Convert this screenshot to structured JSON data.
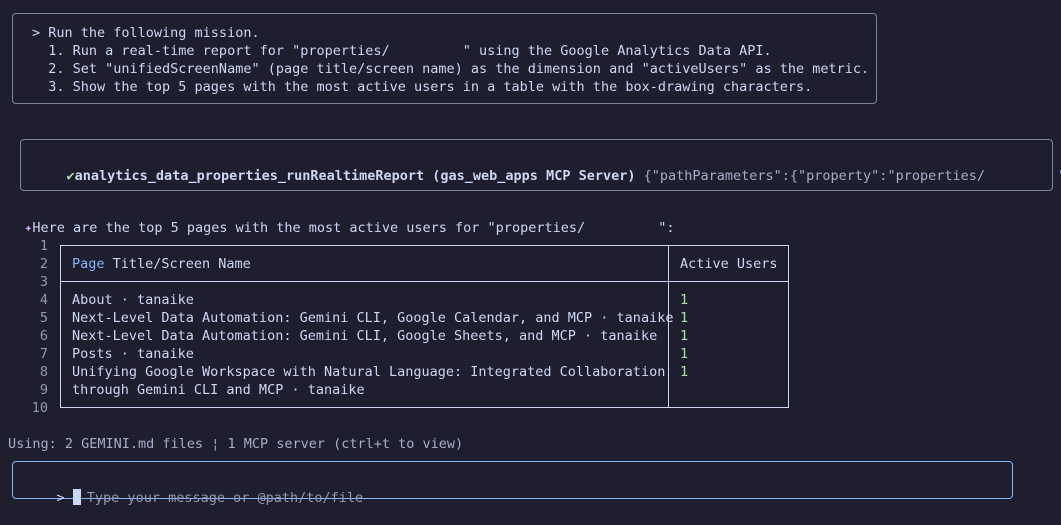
{
  "mission": {
    "lines": [
      "> Run the following mission.",
      "  1. Run a real-time report for \"properties/         \" using the Google Analytics Data API.",
      "  2. Set \"unifiedScreenName\" (page title/screen name) as the dimension and \"activeUsers\" as the metric.",
      "  3. Show the top 5 pages with the most active users in a table with the box-drawing characters."
    ]
  },
  "tool_call": {
    "check": "✔",
    "name": "analytics_data_properties_runRealtimeReport (gas_web_apps MCP Server)",
    "args": "{\"pathParameters\":{\"property\":\"properties/         \"…"
  },
  "response": {
    "star": "✦",
    "text": "Here are the top 5 pages with the most active users for \"properties/         \":"
  },
  "line_numbers": [
    "1",
    "2",
    "3",
    "4",
    "5",
    "6",
    "7",
    "8",
    "9",
    "10"
  ],
  "table": {
    "headers": [
      "Page Title/Screen Name",
      "Active Users"
    ],
    "rows": [
      {
        "page": "About · tanaike",
        "users": "1"
      },
      {
        "page": "Next-Level Data Automation: Gemini CLI, Google Calendar, and MCP · tanaike",
        "users": "1"
      },
      {
        "page": "Next-Level Data Automation: Gemini CLI, Google Sheets, and MCP · tanaike",
        "users": "1"
      },
      {
        "page": "Posts · tanaike",
        "users": "1"
      },
      {
        "page": "Unifying Google Workspace with Natural Language: Integrated Collaboration",
        "users": "1"
      },
      {
        "page": "through Gemini CLI and MCP · tanaike",
        "users": ""
      }
    ]
  },
  "status": {
    "text": "Using: 2 GEMINI.md files ¦ 1 MCP server (ctrl+t to view)"
  },
  "input": {
    "prompt": ">",
    "placeholder": "Type your message or @path/to/file"
  },
  "colors": {
    "background": "#1e1e2e",
    "border": "#7f849c",
    "accent_green": "#a6e3a1",
    "accent_blue": "#89b4fa",
    "accent_purple": "#cba6f7"
  }
}
